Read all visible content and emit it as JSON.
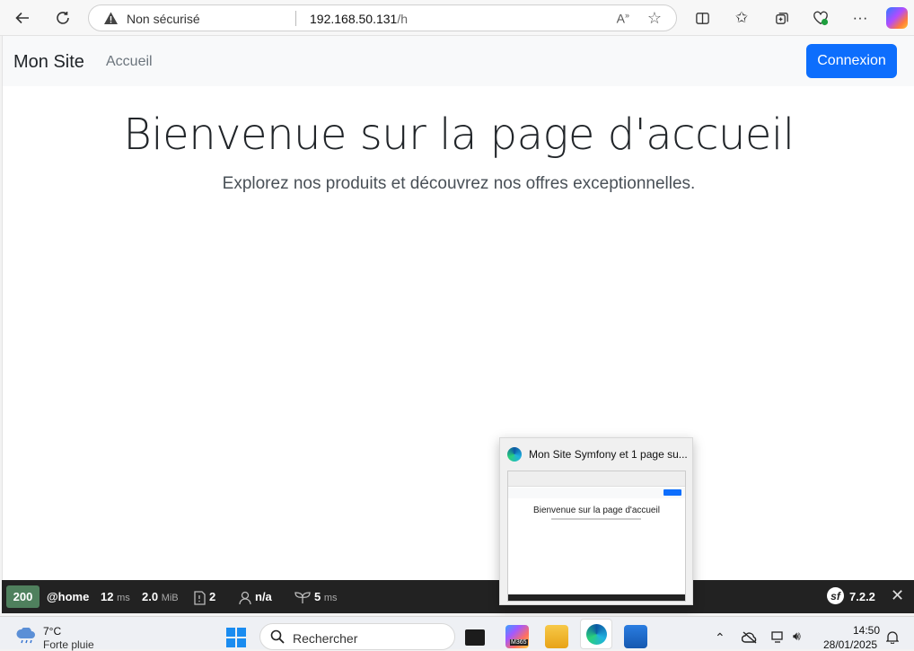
{
  "browser": {
    "security_label": "Non sécurisé",
    "url_host": "192.168.50.131",
    "url_path": "/h"
  },
  "site": {
    "brand": "Mon Site",
    "nav_home": "Accueil",
    "login_label": "Connexion",
    "hero_title": "Bienvenue sur la page d'accueil",
    "hero_subtitle": "Explorez nos produits et découvrez nos offres exceptionnelles."
  },
  "symfony_toolbar": {
    "status_code": "200",
    "route": "@home",
    "time_value": "12",
    "time_unit": "ms",
    "memory_value": "2.0",
    "memory_unit": "MiB",
    "logs_count": "2",
    "user": "n/a",
    "twig_value": "5",
    "twig_unit": "ms",
    "version": "7.2.2"
  },
  "tab_preview": {
    "title": "Mon Site Symfony et 1 page su...",
    "thumb_title": "Bienvenue sur la page d'accueil"
  },
  "taskbar": {
    "weather_temp": "7°C",
    "weather_desc": "Forte pluie",
    "search_placeholder": "Rechercher",
    "clock_time": "14:50",
    "clock_date": "28/01/2025",
    "m365_badge": "M365"
  },
  "colors": {
    "primary": "#0d6efd",
    "status_ok": "#4f805d",
    "toolbar_bg": "#222222"
  }
}
